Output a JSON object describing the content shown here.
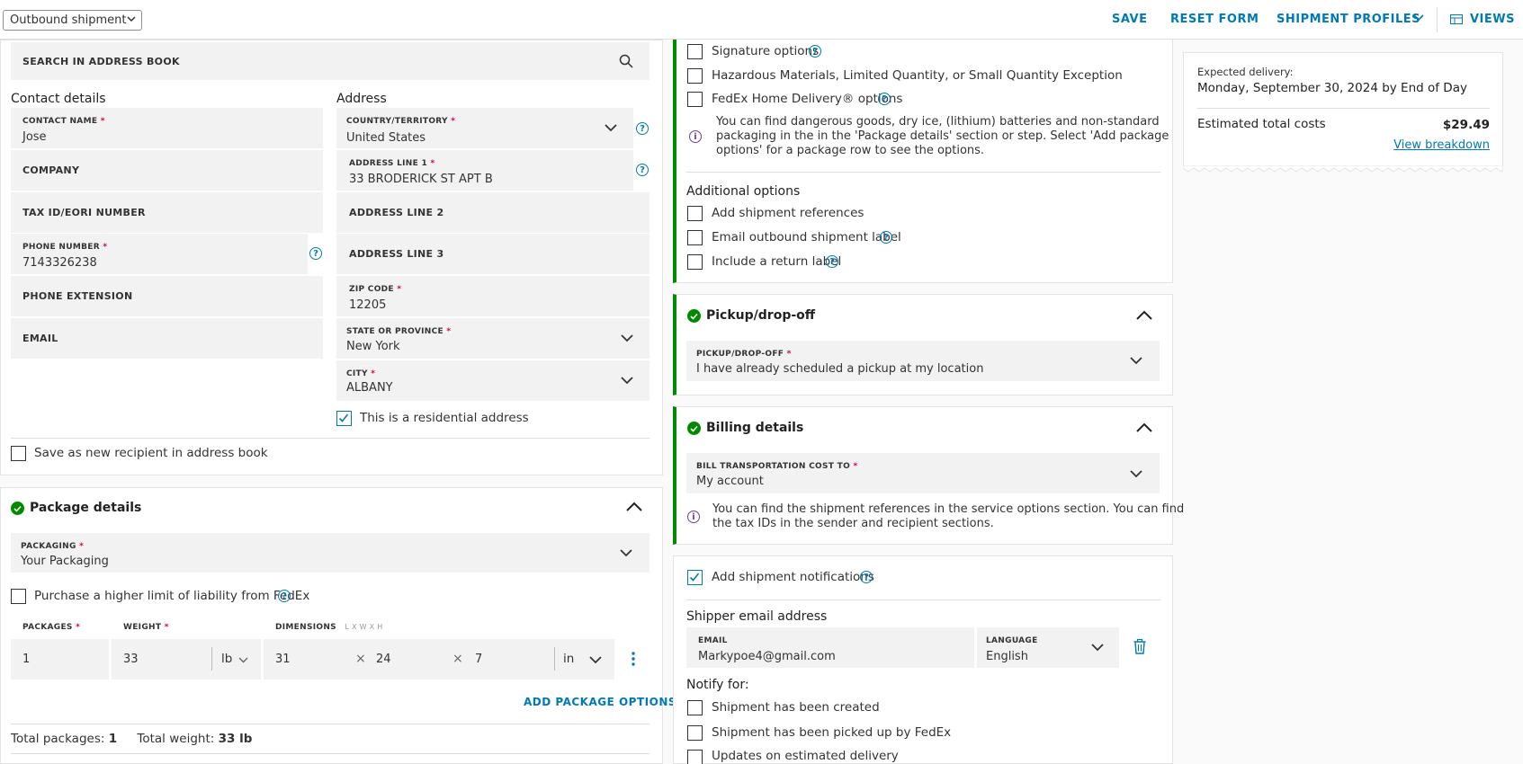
{
  "topbar": {
    "shipment_type": "Outbound shipment",
    "save": "SAVE",
    "reset": "RESET FORM",
    "profiles": "SHIPMENT PROFILES",
    "views": "VIEWS"
  },
  "recipient": {
    "search_label": "SEARCH IN ADDRESS BOOK",
    "contact_heading": "Contact details",
    "address_heading": "Address",
    "contact_name_label": "CONTACT NAME",
    "contact_name": "Jose",
    "company_label": "COMPANY",
    "tax_label": "TAX ID/EORI NUMBER",
    "phone_label": "PHONE NUMBER",
    "phone": "7143326238",
    "phone_ext_label": "PHONE EXTENSION",
    "email_label": "EMAIL",
    "country_label": "COUNTRY/TERRITORY",
    "country": "United States",
    "address1_label": "ADDRESS LINE 1",
    "address1": "33 BRODERICK ST APT B",
    "address2_label": "ADDRESS LINE 2",
    "address3_label": "ADDRESS LINE 3",
    "zip_label": "ZIP CODE",
    "zip": "12205",
    "state_label": "STATE OR PROVINCE",
    "state": "New York",
    "city_label": "CITY",
    "city": "ALBANY",
    "residential": "This is a residential address",
    "save_recipient": "Save as new recipient in address book"
  },
  "package": {
    "title": "Package details",
    "packaging_label": "PACKAGING",
    "packaging": "Your Packaging",
    "liability": "Purchase a higher limit of liability from FedEx",
    "packages_label": "PACKAGES",
    "weight_label": "WEIGHT",
    "dimensions_label": "DIMENSIONS",
    "dims_hint": "L x W x H",
    "packages": "1",
    "weight": "33",
    "weight_unit": "lb",
    "dim_l": "31",
    "dim_w": "24",
    "dim_h": "7",
    "dim_unit": "in",
    "times": "×",
    "add_options": "ADD PACKAGE OPTIONS",
    "total_packages_label": "Total packages:",
    "total_packages": "1",
    "total_weight_label": "Total weight:",
    "total_weight": "33 lb"
  },
  "service_options": {
    "signature": "Signature options",
    "hazmat": "Hazardous Materials, Limited Quantity, or Small Quantity Exception",
    "home_delivery": "FedEx Home Delivery® options",
    "info_line1": "You can find dangerous goods, dry ice, (lithium) batteries and non-standard",
    "info_line2": "packaging in the in the 'Package details' section or step. Select 'Add package",
    "info_line3": "options' for a package row to see the options.",
    "additional_heading": "Additional options",
    "add_refs": "Add shipment references",
    "email_label": "Email outbound shipment label",
    "return_label": "Include a return label"
  },
  "pickup": {
    "title": "Pickup/drop-off",
    "label": "PICKUP/DROP-OFF",
    "value": "I have already scheduled a pickup at my location"
  },
  "billing": {
    "title": "Billing details",
    "label": "BILL TRANSPORTATION COST TO",
    "value": "My account",
    "info_line1": "You can find the shipment references in the service options section. You can find",
    "info_line2": "the tax IDs in the sender and recipient sections."
  },
  "notifications": {
    "add": "Add shipment notifications",
    "shipper_email_heading": "Shipper email address",
    "email_label": "EMAIL",
    "email": "Markypoe4@gmail.com",
    "language_label": "LANGUAGE",
    "language": "English",
    "notify_for": "Notify for:",
    "created": "Shipment has been created",
    "picked_up": "Shipment has been picked up by FedEx",
    "updates": "Updates on estimated delivery"
  },
  "summary": {
    "expected_label": "Expected delivery:",
    "expected": "Monday, September 30, 2024 by End of Day",
    "total_label": "Estimated total costs",
    "total": "$29.49",
    "breakdown": "View breakdown"
  },
  "colors": {
    "accent": "#007ab7",
    "success": "#008a00",
    "required": "#de002e",
    "info": "#6a3e9e"
  }
}
